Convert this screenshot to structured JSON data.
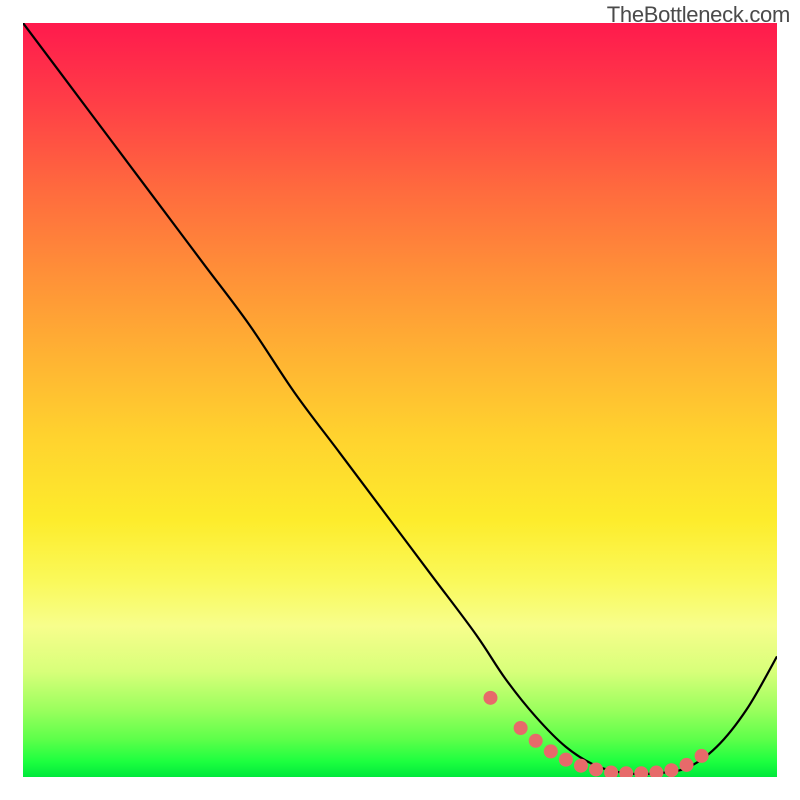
{
  "watermark": "TheBottleneck.com",
  "chart_data": {
    "type": "line",
    "title": "",
    "xlabel": "",
    "ylabel": "",
    "xlim": [
      0,
      100
    ],
    "ylim": [
      0,
      100
    ],
    "series": [
      {
        "name": "bottleneck-curve",
        "x": [
          0,
          6,
          12,
          18,
          24,
          30,
          36,
          42,
          48,
          54,
          60,
          64,
          68,
          72,
          76,
          80,
          84,
          88,
          92,
          96,
          100
        ],
        "values": [
          100,
          92,
          84,
          76,
          68,
          60,
          51,
          43,
          35,
          27,
          19,
          13,
          8,
          4,
          1.5,
          0.5,
          0.5,
          1.2,
          4,
          9,
          16
        ]
      },
      {
        "name": "highlight-dots",
        "x": [
          62,
          66,
          68,
          70,
          72,
          74,
          76,
          78,
          80,
          82,
          84,
          86,
          88,
          90
        ],
        "values": [
          10.5,
          6.5,
          4.8,
          3.4,
          2.3,
          1.5,
          1.0,
          0.6,
          0.5,
          0.5,
          0.6,
          0.9,
          1.6,
          2.8
        ]
      }
    ],
    "gradient_stops": [
      {
        "pos": 0,
        "color": "#ff1a4d"
      },
      {
        "pos": 10,
        "color": "#ff3c47"
      },
      {
        "pos": 22,
        "color": "#ff6a3e"
      },
      {
        "pos": 33,
        "color": "#ff8f38"
      },
      {
        "pos": 44,
        "color": "#ffb233"
      },
      {
        "pos": 55,
        "color": "#ffd32e"
      },
      {
        "pos": 66,
        "color": "#fdec2c"
      },
      {
        "pos": 74,
        "color": "#faf95a"
      },
      {
        "pos": 80,
        "color": "#f7fe8c"
      },
      {
        "pos": 86,
        "color": "#d8ff7a"
      },
      {
        "pos": 91,
        "color": "#9cff5e"
      },
      {
        "pos": 95,
        "color": "#5dff4a"
      },
      {
        "pos": 98,
        "color": "#1cff3f"
      },
      {
        "pos": 100,
        "color": "#00e83c"
      }
    ],
    "dot_color": "#e76a6a",
    "curve_color": "#000000"
  }
}
